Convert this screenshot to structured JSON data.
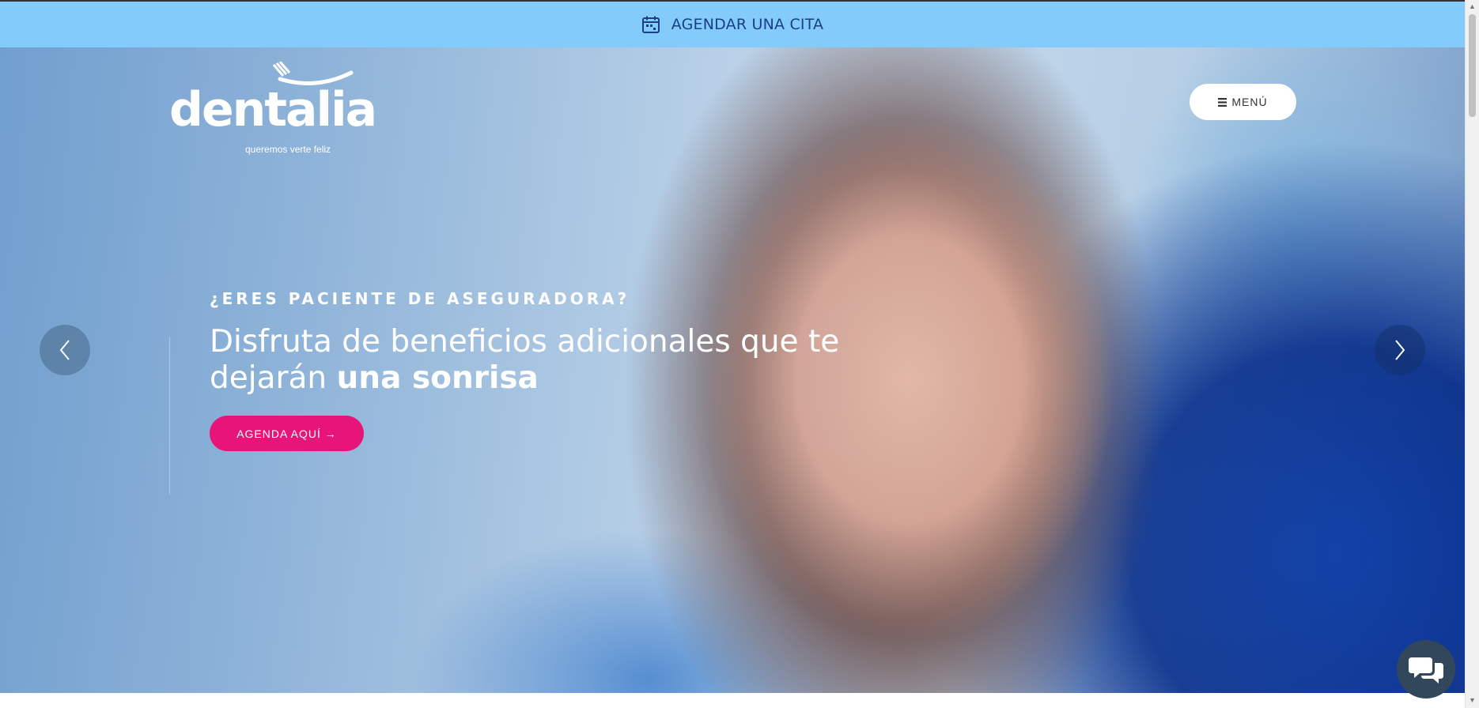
{
  "topbar": {
    "cta_label": "AGENDAR UNA CITA",
    "icon": "calendar-icon",
    "background": "#82cbfa",
    "text_color": "#1b3f86"
  },
  "logo": {
    "wordmark": "dentalia",
    "tagline": "queremos verte feliz"
  },
  "nav": {
    "menu_label": "MENÚ",
    "menu_icon": "hamburger-icon"
  },
  "hero": {
    "eyebrow": "¿ERES PACIENTE DE ASEGURADORA?",
    "headline_part1": "Disfruta de beneficios adicionales que te dejarán ",
    "headline_strong": "una sonrisa",
    "cta_label": "AGENDA AQUÍ →",
    "cta_color": "#e7157a",
    "prev_icon": "chevron-left-icon",
    "next_icon": "chevron-right-icon"
  },
  "chat": {
    "icon": "chat-bubbles-icon"
  }
}
